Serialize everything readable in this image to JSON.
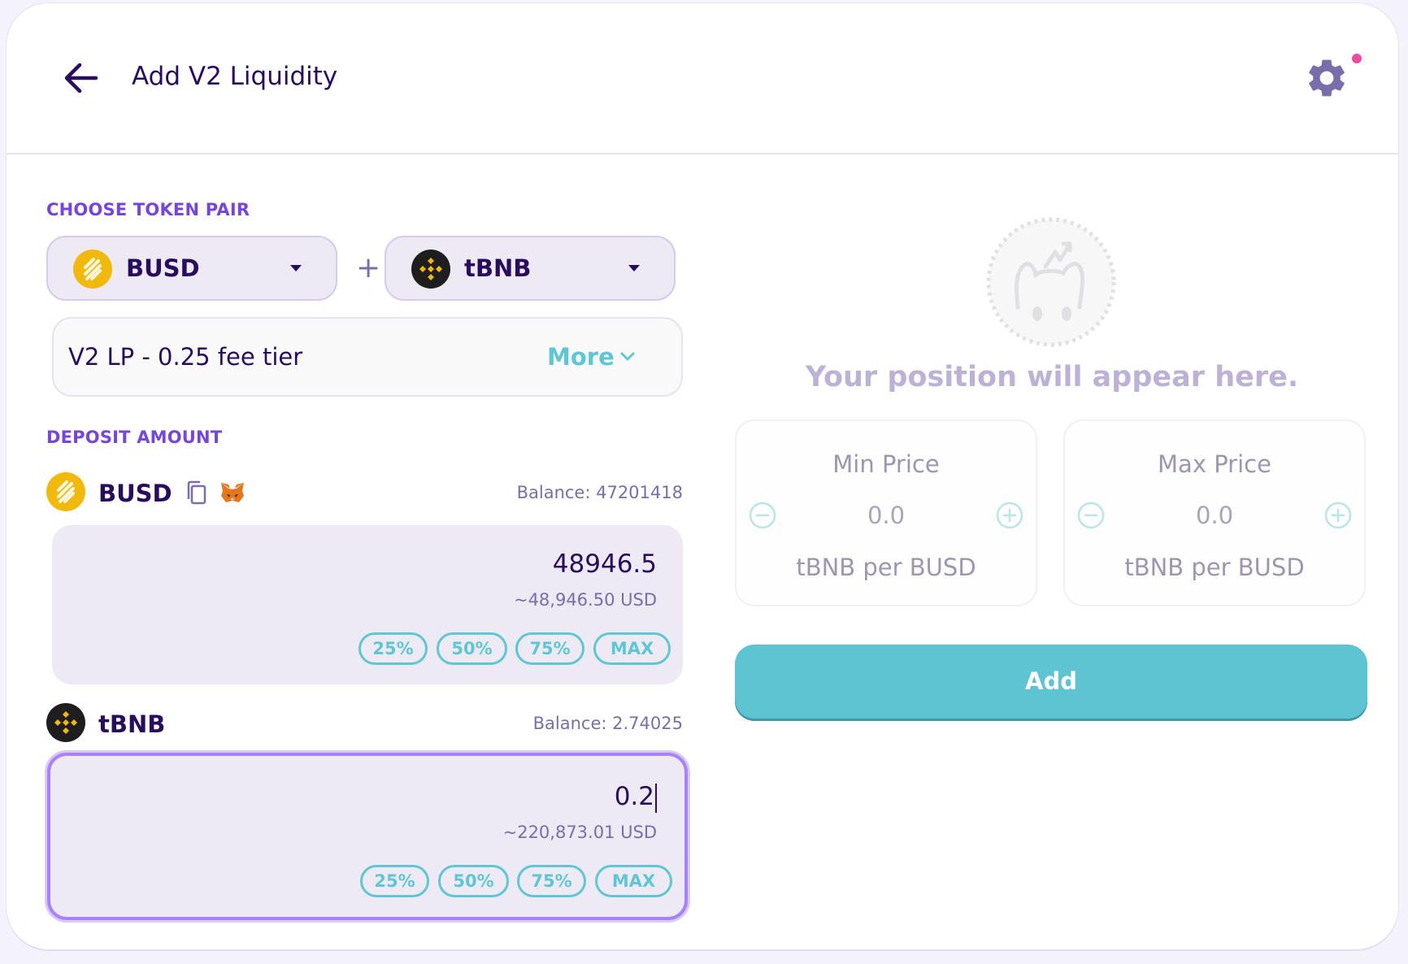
{
  "header": {
    "title": "Add V2 Liquidity"
  },
  "choose_pair": {
    "label": "CHOOSE TOKEN PAIR",
    "token_a": "BUSD",
    "plus": "+",
    "token_b": "tBNB"
  },
  "fee_tier": {
    "label": "V2 LP - 0.25 fee tier",
    "more_label": "More"
  },
  "deposit": {
    "label": "DEPOSIT AMOUNT",
    "token_a": {
      "name": "BUSD",
      "balance": "Balance: 47201418",
      "amount": "48946.5",
      "usd": "~48,946.50 USD"
    },
    "token_b": {
      "name": "tBNB",
      "balance": "Balance: 2.74025",
      "amount": "0.2",
      "usd": "~220,873.01 USD"
    },
    "percent_buttons": [
      "25%",
      "50%",
      "75%",
      "MAX"
    ]
  },
  "position": {
    "message": "Your position will appear here.",
    "min_price": {
      "title": "Min Price",
      "value": "0.0",
      "unit": "tBNB per BUSD"
    },
    "max_price": {
      "title": "Max Price",
      "value": "0.0",
      "unit": "tBNB per BUSD"
    }
  },
  "add_button": "Add",
  "colors": {
    "primary_text": "#280d5f",
    "accent_purple": "#7645d9",
    "accent_cyan": "#5fc7d4",
    "secondary_text": "#7a6eaa",
    "notification": "#ed4b9e",
    "busd_yellow": "#f0b90b"
  },
  "icons": [
    "arrow-left-icon",
    "gear-icon",
    "busd-token-icon",
    "bnb-token-icon",
    "chevron-down-icon",
    "copy-icon",
    "metamask-fox-icon",
    "minus-circle-icon",
    "plus-circle-icon"
  ]
}
